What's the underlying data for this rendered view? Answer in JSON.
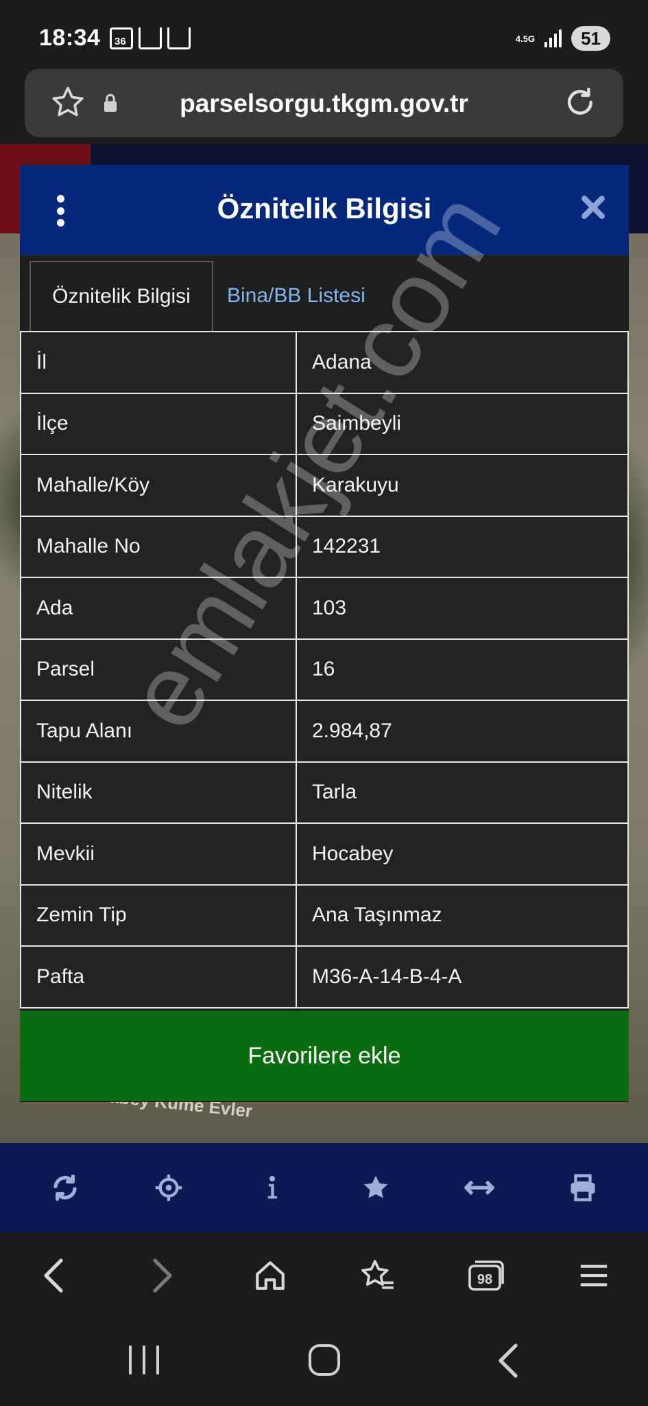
{
  "status_bar": {
    "time": "18:34",
    "network_label": "4.5G",
    "battery": "51"
  },
  "browser": {
    "url": "parselsorgu.tkgm.gov.tr"
  },
  "map": {
    "place_label": "Hocabey Küme Evler"
  },
  "modal": {
    "title": "Öznitelik Bilgisi",
    "tabs": [
      {
        "label": "Öznitelik Bilgisi",
        "active": true
      },
      {
        "label": "Bina/BB Listesi",
        "active": false
      }
    ],
    "rows": [
      {
        "label": "İl",
        "value": "Adana"
      },
      {
        "label": "İlçe",
        "value": "Saimbeyli"
      },
      {
        "label": "Mahalle/Köy",
        "value": "Karakuyu"
      },
      {
        "label": "Mahalle No",
        "value": "142231"
      },
      {
        "label": "Ada",
        "value": "103"
      },
      {
        "label": "Parsel",
        "value": "16"
      },
      {
        "label": "Tapu Alanı",
        "value": "2.984,87"
      },
      {
        "label": "Nitelik",
        "value": "Tarla"
      },
      {
        "label": "Mevkii",
        "value": "Hocabey"
      },
      {
        "label": "Zemin Tip",
        "value": "Ana Taşınmaz"
      },
      {
        "label": "Pafta",
        "value": "M36-A-14-B-4-A"
      }
    ],
    "favorite_button": "Favorilere ekle"
  },
  "watermark": "emlakjet.com",
  "colors": {
    "modal_header": "#06287a",
    "favorite_button": "#0a6e10",
    "tab_link": "#7fb7f2",
    "map_toolbar": "#0a1a55"
  },
  "icons": {
    "map_toolbar": [
      "refresh-icon",
      "locate-icon",
      "info-icon",
      "star-icon",
      "measure-icon",
      "print-icon"
    ],
    "browser_nav": [
      "back-icon",
      "forward-icon",
      "home-icon",
      "bookmarks-icon",
      "tabs-icon",
      "menu-icon"
    ]
  },
  "browser_nav": {
    "tab_count": "98"
  }
}
